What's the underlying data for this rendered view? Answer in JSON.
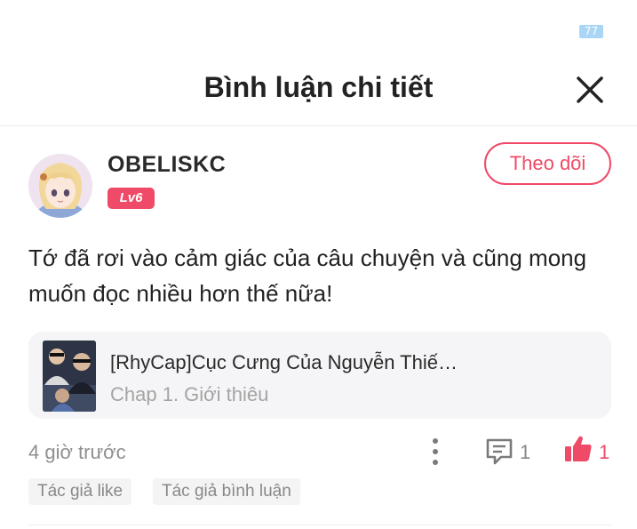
{
  "top_badge": "77",
  "header": {
    "title": "Bình luận chi tiết",
    "close_icon": "close-icon"
  },
  "comment": {
    "author": {
      "name": "OBELISKC",
      "level": "Lv6",
      "avatar_icon": "anime-girl-avatar"
    },
    "follow_label": "Theo dõi",
    "text": "Tớ đã rơi vào cảm giác của câu chuyện và cũng mong muốn đọc nhiều hơn thế nữa!",
    "story": {
      "title": "[RhyCap]Cục Cưng Của Nguyễn Thiế…",
      "chapter": "Chap 1. Giới thiêu"
    },
    "time": "4 giờ trước",
    "reply_count": "1",
    "like_count": "1",
    "tags": [
      "Tác giả like",
      "Tác giả bình luận"
    ]
  },
  "colors": {
    "accent": "#ef4a67",
    "muted_text": "#8f8f8f",
    "card_bg": "#f5f5f7"
  }
}
